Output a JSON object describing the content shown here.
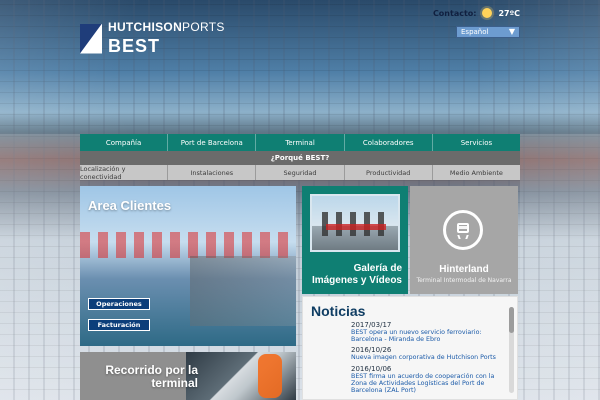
{
  "header": {
    "logo": {
      "top_bold": "HUTCHISON",
      "top_thin": "PORTS",
      "bottom": "BEST"
    },
    "contacto_label": "Contacto:",
    "temperature": "27ºC",
    "language": "Español"
  },
  "nav_primary": [
    "Compañía",
    "Port de Barcelona",
    "Terminal",
    "Colaboradores",
    "Servicios"
  ],
  "nav_secondary": "¿Porqué BEST?",
  "nav_tertiary": [
    "Localización y conectividad",
    "Instalaciones",
    "Seguridad",
    "Productividad",
    "Medio Ambiente"
  ],
  "area_clientes": {
    "title": "Area Clientes",
    "buttons": [
      "Operaciones",
      "Facturación"
    ]
  },
  "galeria": {
    "line1": "Galería de",
    "line2": "Imágenes y Vídeos"
  },
  "hinterland": {
    "title": "Hinterland",
    "subtitle": "Terminal Intermodal de Navarra"
  },
  "noticias": {
    "title": "Noticias",
    "items": [
      {
        "date": "2017/03/17",
        "text": "BEST opera un nuevo servicio ferroviario: Barcelona - Miranda de Ebro"
      },
      {
        "date": "2016/10/26",
        "text": "Nueva imagen corporativa de Hutchison Ports"
      },
      {
        "date": "2016/10/06",
        "text": "BEST firma un acuerdo de cooperación con la Zona de Actividades Logísticas del Port de Barcelona (ZAL Port)"
      }
    ]
  },
  "recorrido": {
    "line1": "Recorrido por la",
    "line2": "terminal"
  }
}
